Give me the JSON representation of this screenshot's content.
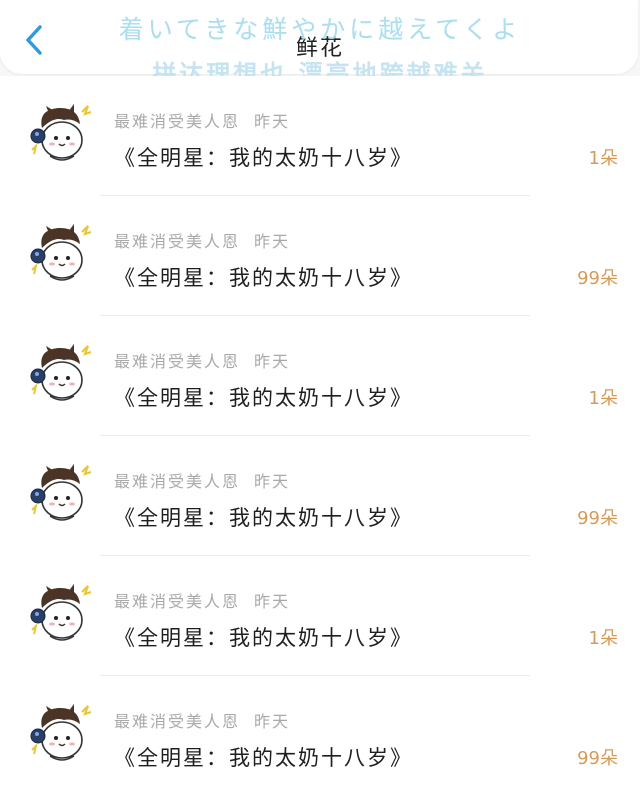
{
  "header": {
    "title": "鲜花",
    "overlay_line1": "着いてきな鮮やかに越えてくよ",
    "overlay_line2": "拼达理想也 漂亮地跨越难关"
  },
  "colors": {
    "accent_blue": "#2f9bdc",
    "amount_orange": "#d99a55"
  },
  "items": [
    {
      "sender": "最难消受美人恩",
      "time": "昨天",
      "title": "《全明星：我的太奶十八岁》",
      "amount": "1朵"
    },
    {
      "sender": "最难消受美人恩",
      "time": "昨天",
      "title": "《全明星：我的太奶十八岁》",
      "amount": "99朵"
    },
    {
      "sender": "最难消受美人恩",
      "time": "昨天",
      "title": "《全明星：我的太奶十八岁》",
      "amount": "1朵"
    },
    {
      "sender": "最难消受美人恩",
      "time": "昨天",
      "title": "《全明星：我的太奶十八岁》",
      "amount": "99朵"
    },
    {
      "sender": "最难消受美人恩",
      "time": "昨天",
      "title": "《全明星：我的太奶十八岁》",
      "amount": "1朵"
    },
    {
      "sender": "最难消受美人恩",
      "time": "昨天",
      "title": "《全明星：我的太奶十八岁》",
      "amount": "99朵"
    }
  ]
}
